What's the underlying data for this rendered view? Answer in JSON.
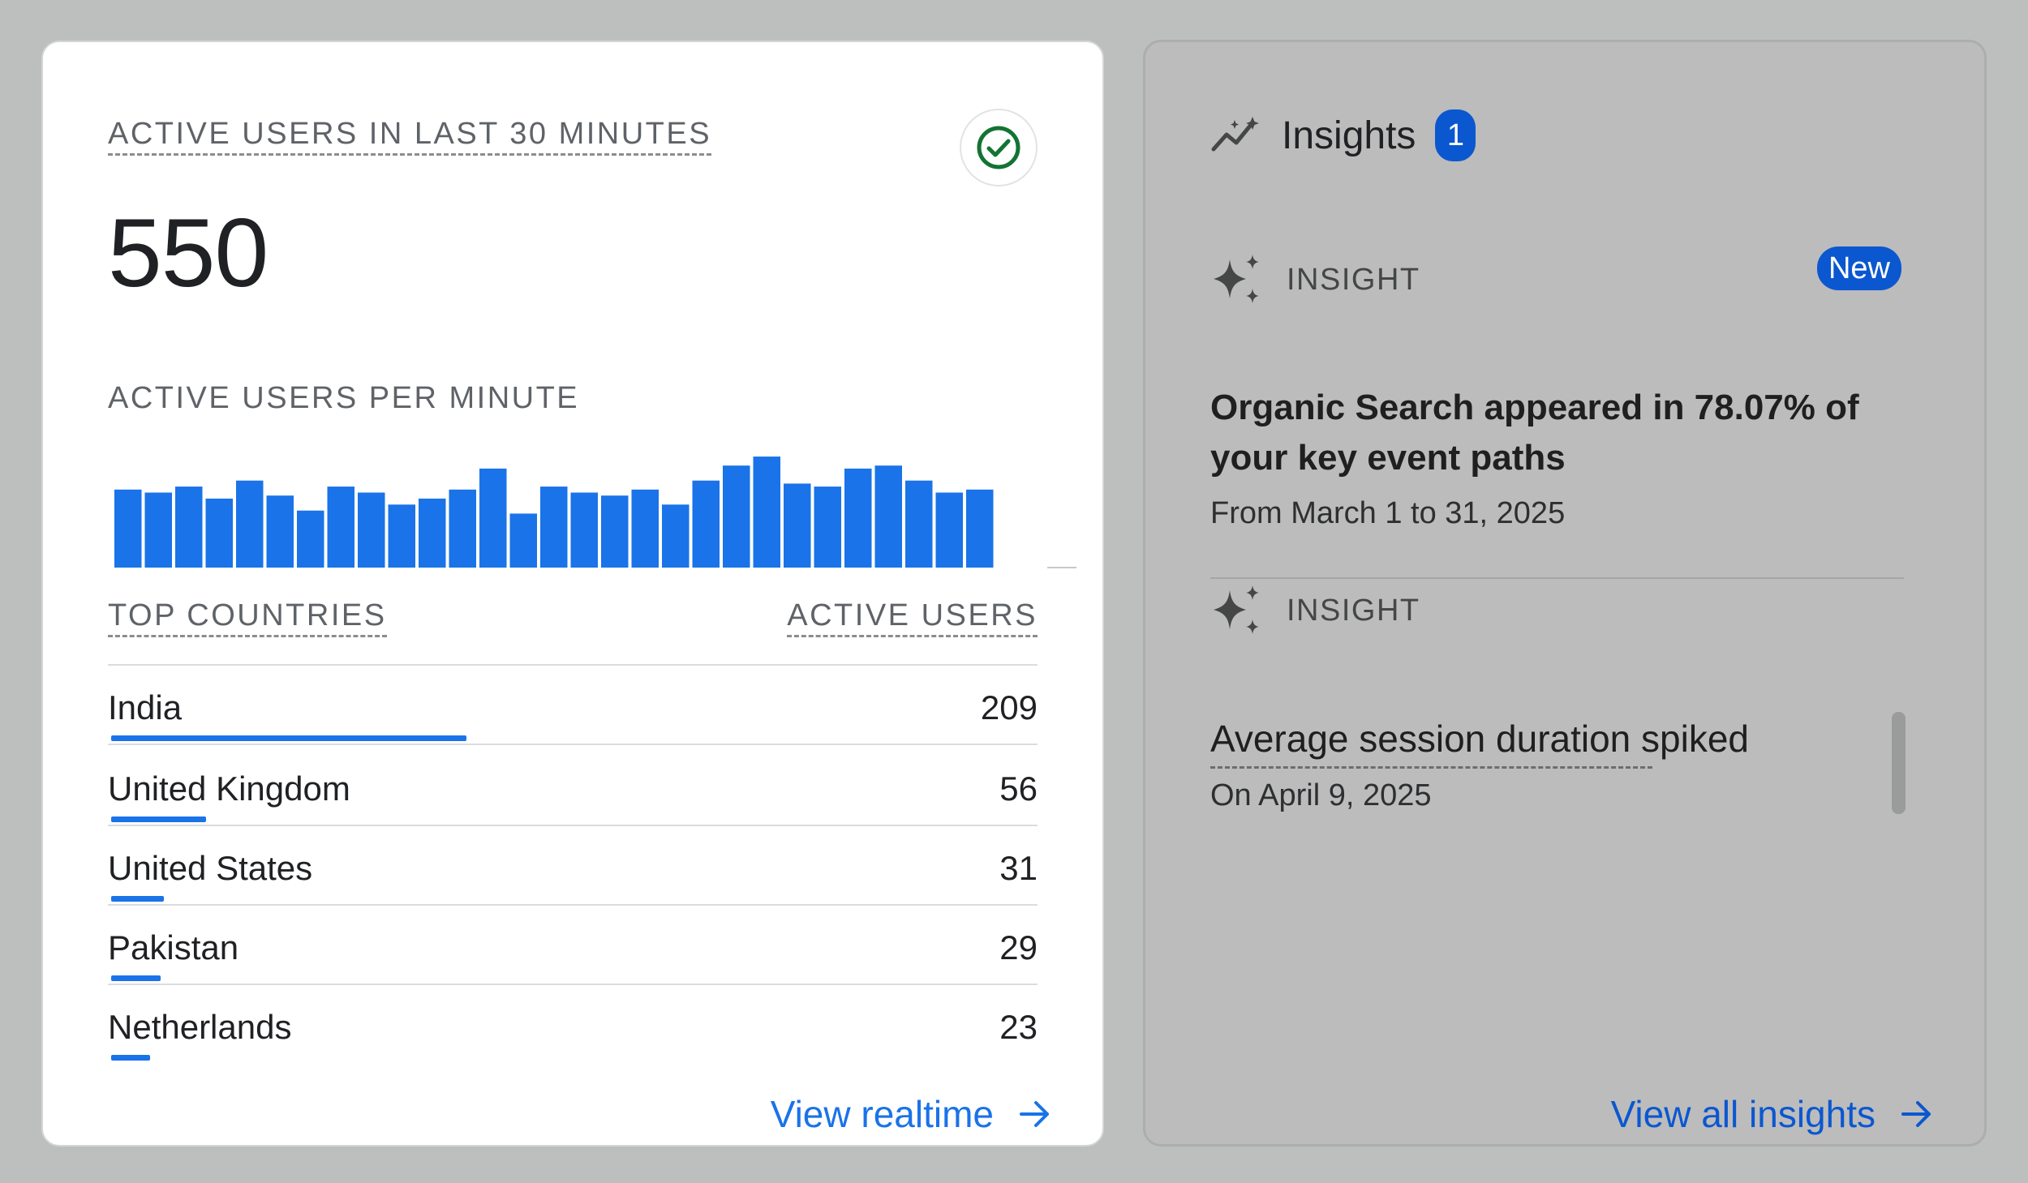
{
  "realtime": {
    "active_users_title": "ACTIVE USERS IN LAST 30 MINUTES",
    "active_users_count": "550",
    "per_minute_title": "ACTIVE USERS PER MINUTE",
    "top_countries_header": "TOP COUNTRIES",
    "active_users_header": "ACTIVE USERS",
    "countries": [
      {
        "name": "India",
        "value": "209",
        "share": 1.0
      },
      {
        "name": "United Kingdom",
        "value": "56",
        "share": 0.268
      },
      {
        "name": "United States",
        "value": "31",
        "share": 0.148
      },
      {
        "name": "Pakistan",
        "value": "29",
        "share": 0.139
      },
      {
        "name": "Netherlands",
        "value": "23",
        "share": 0.11
      }
    ],
    "view_realtime_label": "View realtime",
    "status_icon": "check-circle-icon",
    "accent_color": "#1a73e8"
  },
  "chart_data": {
    "type": "bar",
    "title": "ACTIVE USERS PER MINUTE",
    "values": [
      26,
      25,
      27,
      23,
      29,
      24,
      19,
      27,
      25,
      21,
      23,
      26,
      33,
      18,
      27,
      25,
      24,
      26,
      21,
      29,
      34,
      37,
      28,
      27,
      33,
      34,
      29,
      25,
      26,
      0
    ],
    "ylim": [
      0,
      40
    ],
    "grid": false
  },
  "insights": {
    "title": "Insights",
    "count": "1",
    "items": [
      {
        "label": "INSIGHT",
        "badge": "New",
        "text": "Organic Search appeared in 78.07% of your key event paths",
        "date": "From March 1 to 31, 2025"
      },
      {
        "label": "INSIGHT",
        "text": "Average session duration spiked",
        "date": "On April 9, 2025"
      }
    ],
    "view_all_label": "View all insights",
    "badge_color": "#0b57d0"
  }
}
